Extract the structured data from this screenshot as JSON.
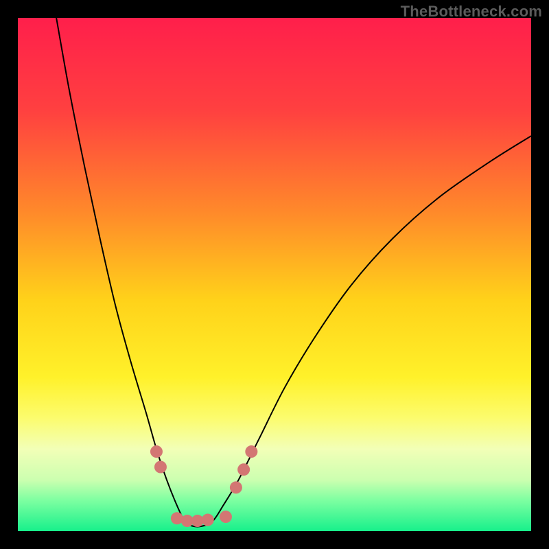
{
  "watermark": "TheBottleneck.com",
  "chart_data": {
    "type": "line",
    "title": "",
    "xlabel": "",
    "ylabel": "",
    "xlim": [
      0,
      100
    ],
    "ylim": [
      0,
      100
    ],
    "grid": false,
    "legend": false,
    "gradient_stops": [
      {
        "offset": 0,
        "color": "#ff1f4b"
      },
      {
        "offset": 18,
        "color": "#ff4040"
      },
      {
        "offset": 38,
        "color": "#ff8a2a"
      },
      {
        "offset": 55,
        "color": "#ffd21a"
      },
      {
        "offset": 70,
        "color": "#fff12a"
      },
      {
        "offset": 78,
        "color": "#fcfc6e"
      },
      {
        "offset": 84,
        "color": "#f2ffb7"
      },
      {
        "offset": 90,
        "color": "#ccffb0"
      },
      {
        "offset": 94,
        "color": "#7dffa1"
      },
      {
        "offset": 100,
        "color": "#17f08b"
      }
    ],
    "series": [
      {
        "name": "bottleneck-curve",
        "color": "#000000",
        "x": [
          7.5,
          10,
          13,
          16,
          19,
          22,
          25,
          27,
          29,
          31,
          32.5,
          34,
          36,
          38,
          40,
          43,
          47,
          52,
          58,
          65,
          73,
          82,
          92,
          100
        ],
        "values": [
          100,
          86,
          71,
          57,
          44,
          33,
          23,
          16,
          10,
          5,
          2,
          1,
          1,
          2,
          5,
          10,
          18,
          28,
          38,
          48,
          57,
          65,
          72,
          77
        ]
      }
    ],
    "markers": {
      "name": "highlight-dots",
      "color": "#d37673",
      "radius": 9,
      "points": [
        {
          "x": 27.0,
          "y": 15.5
        },
        {
          "x": 27.8,
          "y": 12.5
        },
        {
          "x": 31.0,
          "y": 2.5
        },
        {
          "x": 33.0,
          "y": 2.0
        },
        {
          "x": 35.0,
          "y": 2.0
        },
        {
          "x": 37.0,
          "y": 2.2
        },
        {
          "x": 40.5,
          "y": 2.8
        },
        {
          "x": 42.5,
          "y": 8.5
        },
        {
          "x": 44.0,
          "y": 12.0
        },
        {
          "x": 45.5,
          "y": 15.5
        }
      ]
    }
  }
}
